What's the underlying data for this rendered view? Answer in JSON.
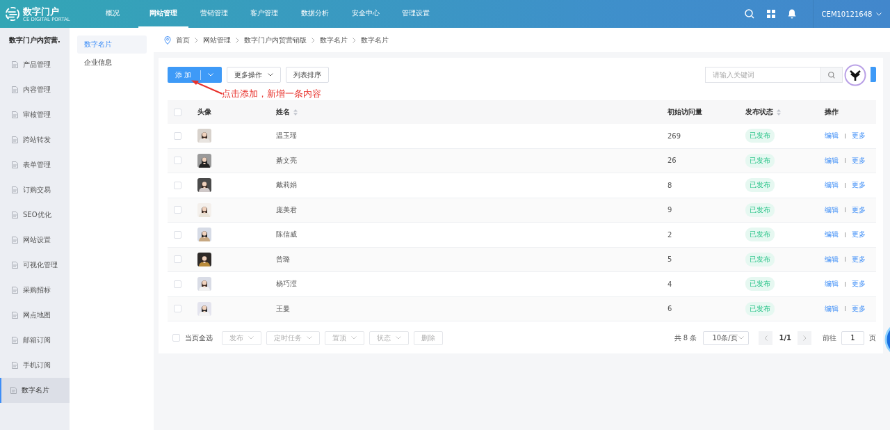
{
  "brand": {
    "name": "数字门户",
    "tagline": "CE DIGITAL PORTAL"
  },
  "nav": [
    {
      "label": "概况",
      "selected": false
    },
    {
      "label": "网站管理",
      "selected": true
    },
    {
      "label": "营销管理",
      "selected": false
    },
    {
      "label": "客户管理",
      "selected": false
    },
    {
      "label": "数据分析",
      "selected": false
    },
    {
      "label": "安全中心",
      "selected": false
    },
    {
      "label": "管理设置",
      "selected": false
    }
  ],
  "user": {
    "name": "CEM10121648"
  },
  "sidebar": {
    "title": "数字门户内贸营.",
    "items": [
      {
        "label": "产品管理",
        "selected": false
      },
      {
        "label": "内容管理",
        "selected": false
      },
      {
        "label": "审核管理",
        "selected": false
      },
      {
        "label": "跨站转发",
        "selected": false
      },
      {
        "label": "表单管理",
        "selected": false
      },
      {
        "label": "订购交易",
        "selected": false
      },
      {
        "label": "SEO优化",
        "selected": false
      },
      {
        "label": "网站设置",
        "selected": false
      },
      {
        "label": "可视化管理",
        "selected": false
      },
      {
        "label": "采购招标",
        "selected": false
      },
      {
        "label": "网点地图",
        "selected": false
      },
      {
        "label": "邮箱订阅",
        "selected": false
      },
      {
        "label": "手机订阅",
        "selected": false
      },
      {
        "label": "数字名片",
        "selected": true
      }
    ]
  },
  "subnav": [
    {
      "label": "数字名片",
      "selected": true
    },
    {
      "label": "企业信息",
      "selected": false
    }
  ],
  "breadcrumb": [
    "首页",
    "网站管理",
    "数字门户内贸营销版",
    "数字名片",
    "数字名片"
  ],
  "toolbar": {
    "add": "添 加",
    "more": "更多操作",
    "sort": "列表排序",
    "search": {
      "placeholder": "请输入关键词"
    }
  },
  "annotation": "点击添加，新增一条内容",
  "table": {
    "select_all_checked": false,
    "columns": [
      "头像",
      "姓名",
      "初始访问量",
      "发布状态",
      "操作"
    ],
    "rows": [
      {
        "checked": false,
        "name": "温玉瑶",
        "visits": "269",
        "status": "已发布",
        "actions": [
          "编辑",
          "更多"
        ]
      },
      {
        "checked": false,
        "name": "綦文亮",
        "visits": "26",
        "status": "已发布",
        "actions": [
          "编辑",
          "更多"
        ]
      },
      {
        "checked": false,
        "name": "戴莉娟",
        "visits": "8",
        "status": "已发布",
        "actions": [
          "编辑",
          "更多"
        ]
      },
      {
        "checked": false,
        "name": "庞美君",
        "visits": "9",
        "status": "已发布",
        "actions": [
          "编辑",
          "更多"
        ]
      },
      {
        "checked": false,
        "name": "陈信威",
        "visits": "2",
        "status": "已发布",
        "actions": [
          "编辑",
          "更多"
        ]
      },
      {
        "checked": false,
        "name": "曾璐",
        "visits": "5",
        "status": "已发布",
        "actions": [
          "编辑",
          "更多"
        ]
      },
      {
        "checked": false,
        "name": "杨巧滢",
        "visits": "4",
        "status": "已发布",
        "actions": [
          "编辑",
          "更多"
        ]
      },
      {
        "checked": false,
        "name": "王曼",
        "visits": "6",
        "status": "已发布",
        "actions": [
          "编辑",
          "更多"
        ]
      }
    ]
  },
  "footer": {
    "select_all": {
      "label": "当页全选",
      "checked": false
    },
    "bulk_actions": [
      {
        "label": "发布",
        "dropdown": true
      },
      {
        "label": "定时任务",
        "dropdown": true
      },
      {
        "label": "置顶",
        "dropdown": true
      },
      {
        "label": "状态",
        "dropdown": true
      },
      {
        "label": "删除",
        "dropdown": false
      }
    ]
  },
  "pagination": {
    "total": "共 8 条",
    "page_size": "10条/页",
    "page": "1/1",
    "goto_label": "前往",
    "goto_value": "1",
    "page_unit": "页"
  }
}
